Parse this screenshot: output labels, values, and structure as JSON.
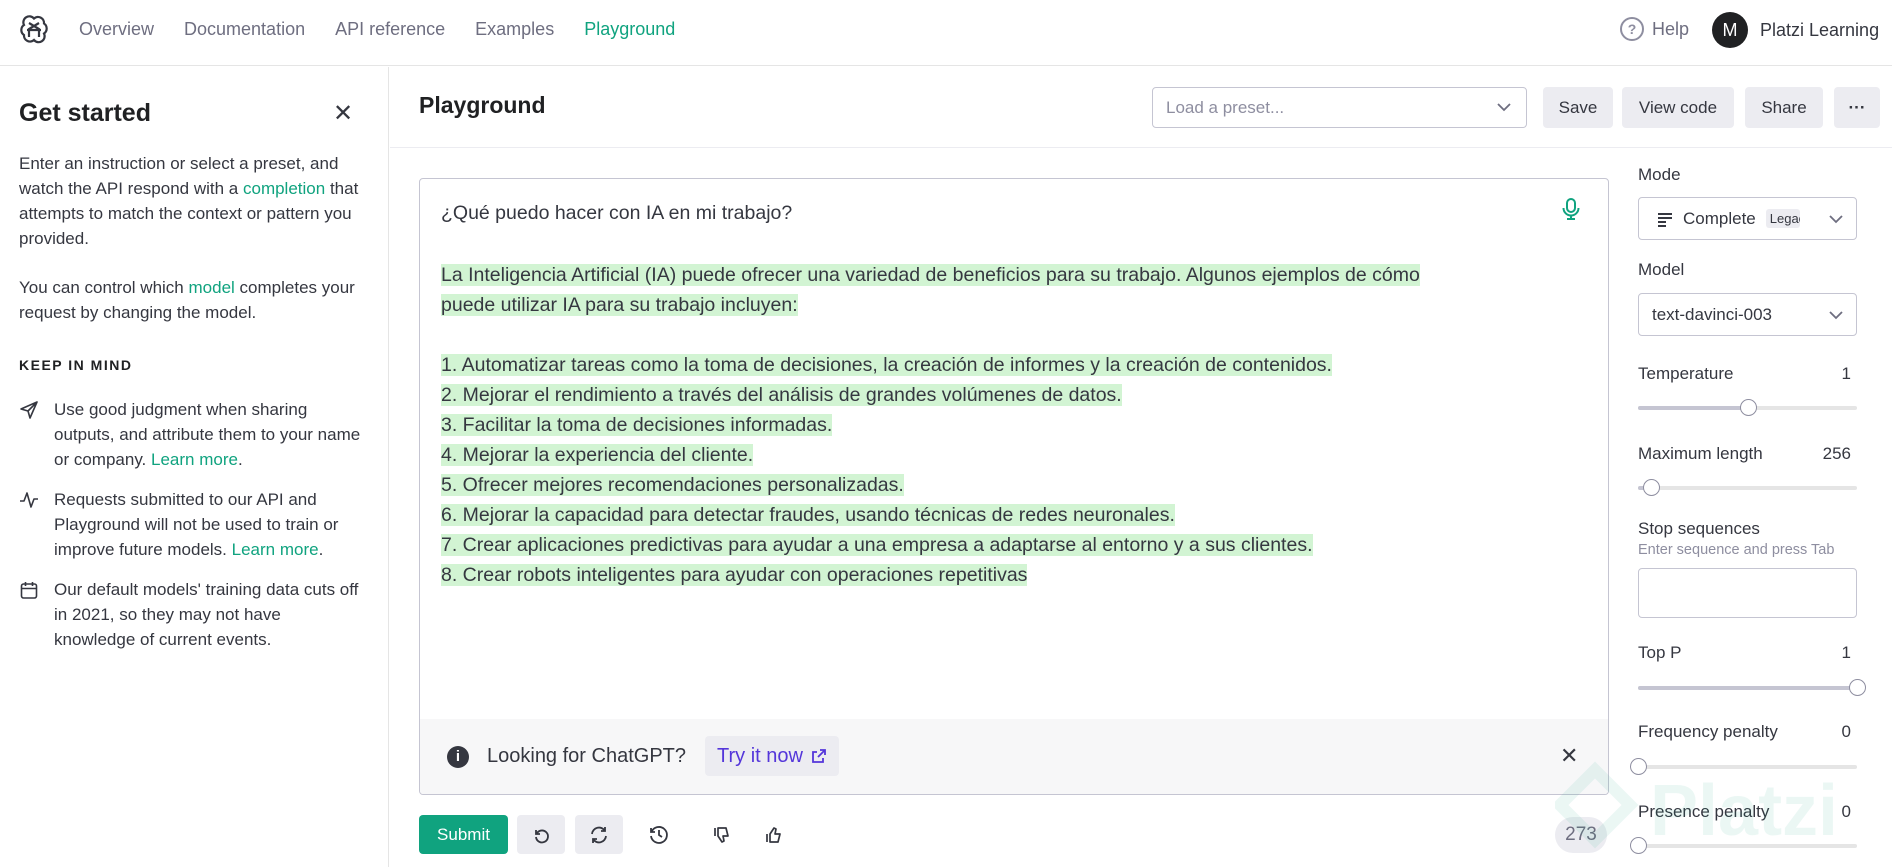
{
  "nav": {
    "links": [
      "Overview",
      "Documentation",
      "API reference",
      "Examples",
      "Playground"
    ],
    "active": "Playground",
    "help": "Help",
    "avatar_initial": "M",
    "user_name": "Platzi Learning"
  },
  "sidebar": {
    "title": "Get started",
    "intro_1": "Enter an instruction or select a preset, and watch the API respond with a",
    "intro_link": "completion",
    "intro_2": "that attempts to match the context or pattern you provided.",
    "model_1": "You can control which",
    "model_link": "model",
    "model_2": "completes your request by changing the model.",
    "keep_in_mind": "KEEP IN MIND",
    "tips": [
      {
        "icon": "send-icon",
        "text": "Use good judgment when sharing outputs, and attribute them to your name or company.",
        "link": "Learn more"
      },
      {
        "icon": "activity-icon",
        "text": "Requests submitted to our API and Playground will not be used to train or improve future models.",
        "link": "Learn more"
      },
      {
        "icon": "calendar-icon",
        "text": "Our default models' training data cuts off in 2021, so they may not have knowledge of current events.",
        "link": ""
      }
    ]
  },
  "main": {
    "title": "Playground",
    "preset_placeholder": "Load a preset...",
    "save": "Save",
    "view_code": "View code",
    "share": "Share",
    "more": "···"
  },
  "editor": {
    "prompt": "¿Qué puedo hacer con IA en mi trabajo?",
    "completion_lines": [
      "La Inteligencia Artificial (IA) puede ofrecer una variedad de beneficios para su trabajo. Algunos ejemplos de cómo",
      "puede utilizar IA para su trabajo incluyen:",
      "",
      "1. Automatizar tareas como la toma de decisiones, la creación de informes y la creación de contenidos.",
      "2. Mejorar el rendimiento a través del análisis de grandes volúmenes de datos.",
      "3. Facilitar la toma de decisiones informadas.",
      "4. Mejorar la experiencia del cliente.",
      "5. Ofrecer mejores recomendaciones personalizadas.",
      "6. Mejorar la capacidad para detectar fraudes, usando técnicas de redes neuronales. ",
      "7. Crear aplicaciones predictivas para ayudar a una empresa a adaptarse al entorno y a sus clientes.",
      "8. Crear robots inteligentes para ayudar con operaciones repetitivas"
    ],
    "highlight_color": "#d2f4d3",
    "banner_text": "Looking for ChatGPT?",
    "banner_link": "Try it now"
  },
  "controls": {
    "submit": "Submit",
    "token_count": "273"
  },
  "settings": {
    "mode_label": "Mode",
    "mode_value": "Complete",
    "mode_badge": "Legacy",
    "model_label": "Model",
    "model_value": "text-davinci-003",
    "temperature": {
      "label": "Temperature",
      "value": "1",
      "fraction": 0.5
    },
    "max_length": {
      "label": "Maximum length",
      "value": "256",
      "fraction": 0.06
    },
    "stop_label": "Stop sequences",
    "stop_hint": "Enter sequence and press Tab",
    "top_p": {
      "label": "Top P",
      "value": "1",
      "fraction": 1.0
    },
    "frequency_penalty": {
      "label": "Frequency penalty",
      "value": "0",
      "fraction": 0.0
    },
    "presence_penalty": {
      "label": "Presence penalty",
      "value": "0",
      "fraction": 0.0
    }
  },
  "colors": {
    "accent": "#10a37f",
    "link_purple": "#5436da"
  },
  "watermark_text": "Platzi"
}
